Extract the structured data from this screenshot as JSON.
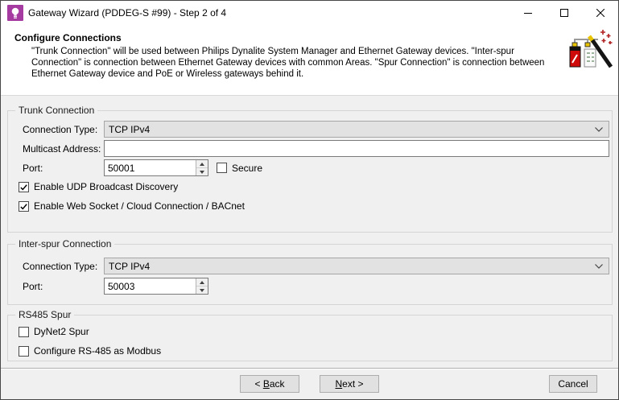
{
  "window": {
    "title": "Gateway Wizard (PDDEG-S #99) - Step 2 of 4"
  },
  "header": {
    "title": "Configure Connections",
    "description": "\"Trunk Connection\" will be used between Philips Dynalite System Manager and Ethernet Gateway devices. \"Inter-spur Connection\" is connection between Ethernet Gateway devices with common Areas. \"Spur Connection\" is connection between Ethernet Gateway device and PoE or Wireless gateways behind it."
  },
  "trunk": {
    "group_label": "Trunk Connection",
    "connection_type_label": "Connection Type:",
    "connection_type_value": "TCP IPv4",
    "multicast_label": "Multicast Address:",
    "multicast_value": "",
    "port_label": "Port:",
    "port_value": "50001",
    "secure_label": "Secure",
    "secure_checked": false,
    "udp_label": "Enable UDP Broadcast Discovery",
    "udp_checked": true,
    "websocket_label": "Enable Web Socket / Cloud Connection / BACnet",
    "websocket_checked": true
  },
  "interspur": {
    "group_label": "Inter-spur Connection",
    "connection_type_label": "Connection Type:",
    "connection_type_value": "TCP IPv4",
    "port_label": "Port:",
    "port_value": "50003"
  },
  "rs485": {
    "group_label": "RS485 Spur",
    "dynet2_label": "DyNet2 Spur",
    "dynet2_checked": false,
    "modbus_label": "Configure RS-485 as Modbus",
    "modbus_checked": false
  },
  "buttons": {
    "back": {
      "pre": "< ",
      "key": "B",
      "rest": "ack"
    },
    "next": {
      "pre": "",
      "key": "N",
      "rest": "ext >"
    },
    "cancel": "Cancel"
  },
  "colors": {
    "accent_purple": "#a53ba0",
    "dialog_bg": "#f0f0f0",
    "combo_bg": "#e2e2e2"
  }
}
